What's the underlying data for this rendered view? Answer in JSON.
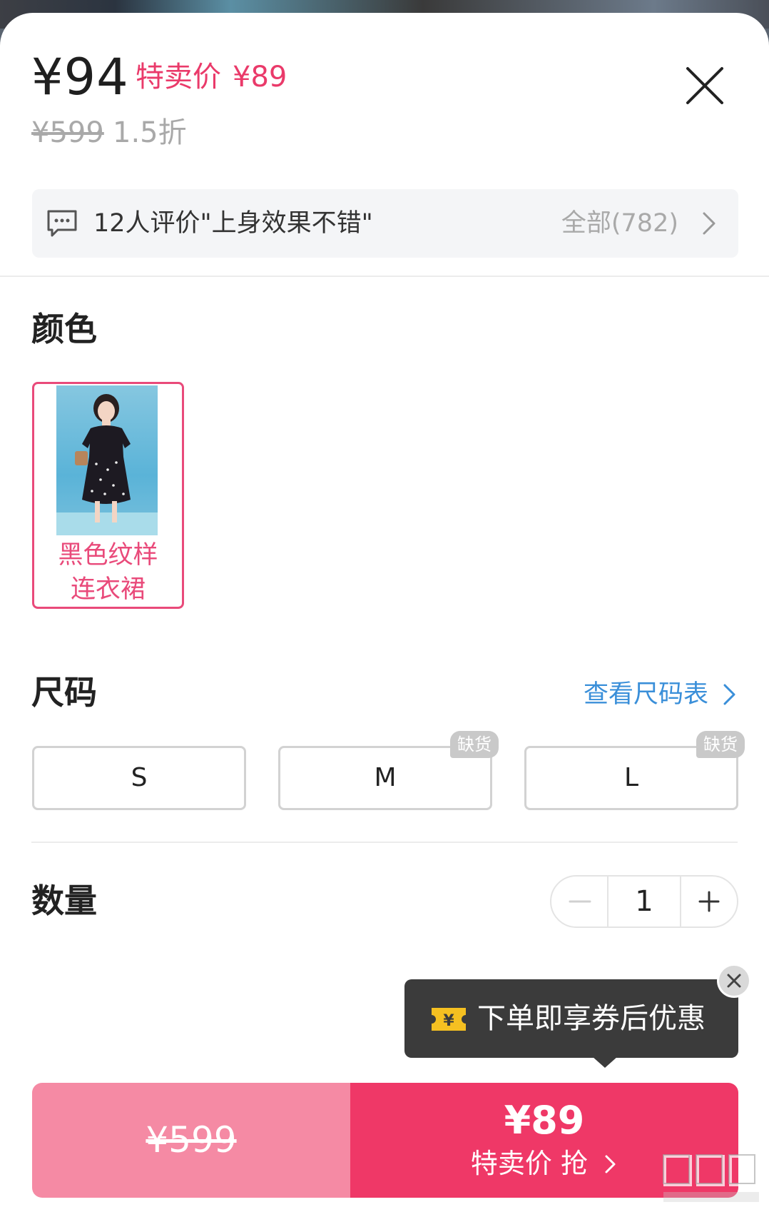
{
  "header": {
    "price": "¥94",
    "sale_label": "特卖价",
    "sale_price": "¥89",
    "original_price": "¥599",
    "discount": "1.5折"
  },
  "review": {
    "summary": "12人评价\"上身效果不错\"",
    "all": "全部(782)"
  },
  "color": {
    "title": "颜色",
    "options": [
      {
        "label_line1": "黑色纹样",
        "label_line2": "连衣裙",
        "selected": true
      }
    ]
  },
  "size": {
    "title": "尺码",
    "guide": "查看尺码表",
    "options": [
      {
        "label": "S",
        "badge": ""
      },
      {
        "label": "M",
        "badge": "缺货"
      },
      {
        "label": "L",
        "badge": "缺货"
      }
    ]
  },
  "quantity": {
    "title": "数量",
    "value": "1"
  },
  "tooltip": {
    "text": "下单即享券后优惠"
  },
  "bottom": {
    "original_price": "¥599",
    "sale_price": "¥89",
    "sale_action": "特卖价 抢"
  },
  "colors": {
    "accent": "#ef3867",
    "accent_light": "#f58aa4",
    "link": "#3a8fd9",
    "muted": "#a9a9a9"
  },
  "icons": [
    "close-icon",
    "comment-icon",
    "chevron-right-icon",
    "minus-icon",
    "plus-icon",
    "coupon-icon",
    "close-small-icon"
  ]
}
